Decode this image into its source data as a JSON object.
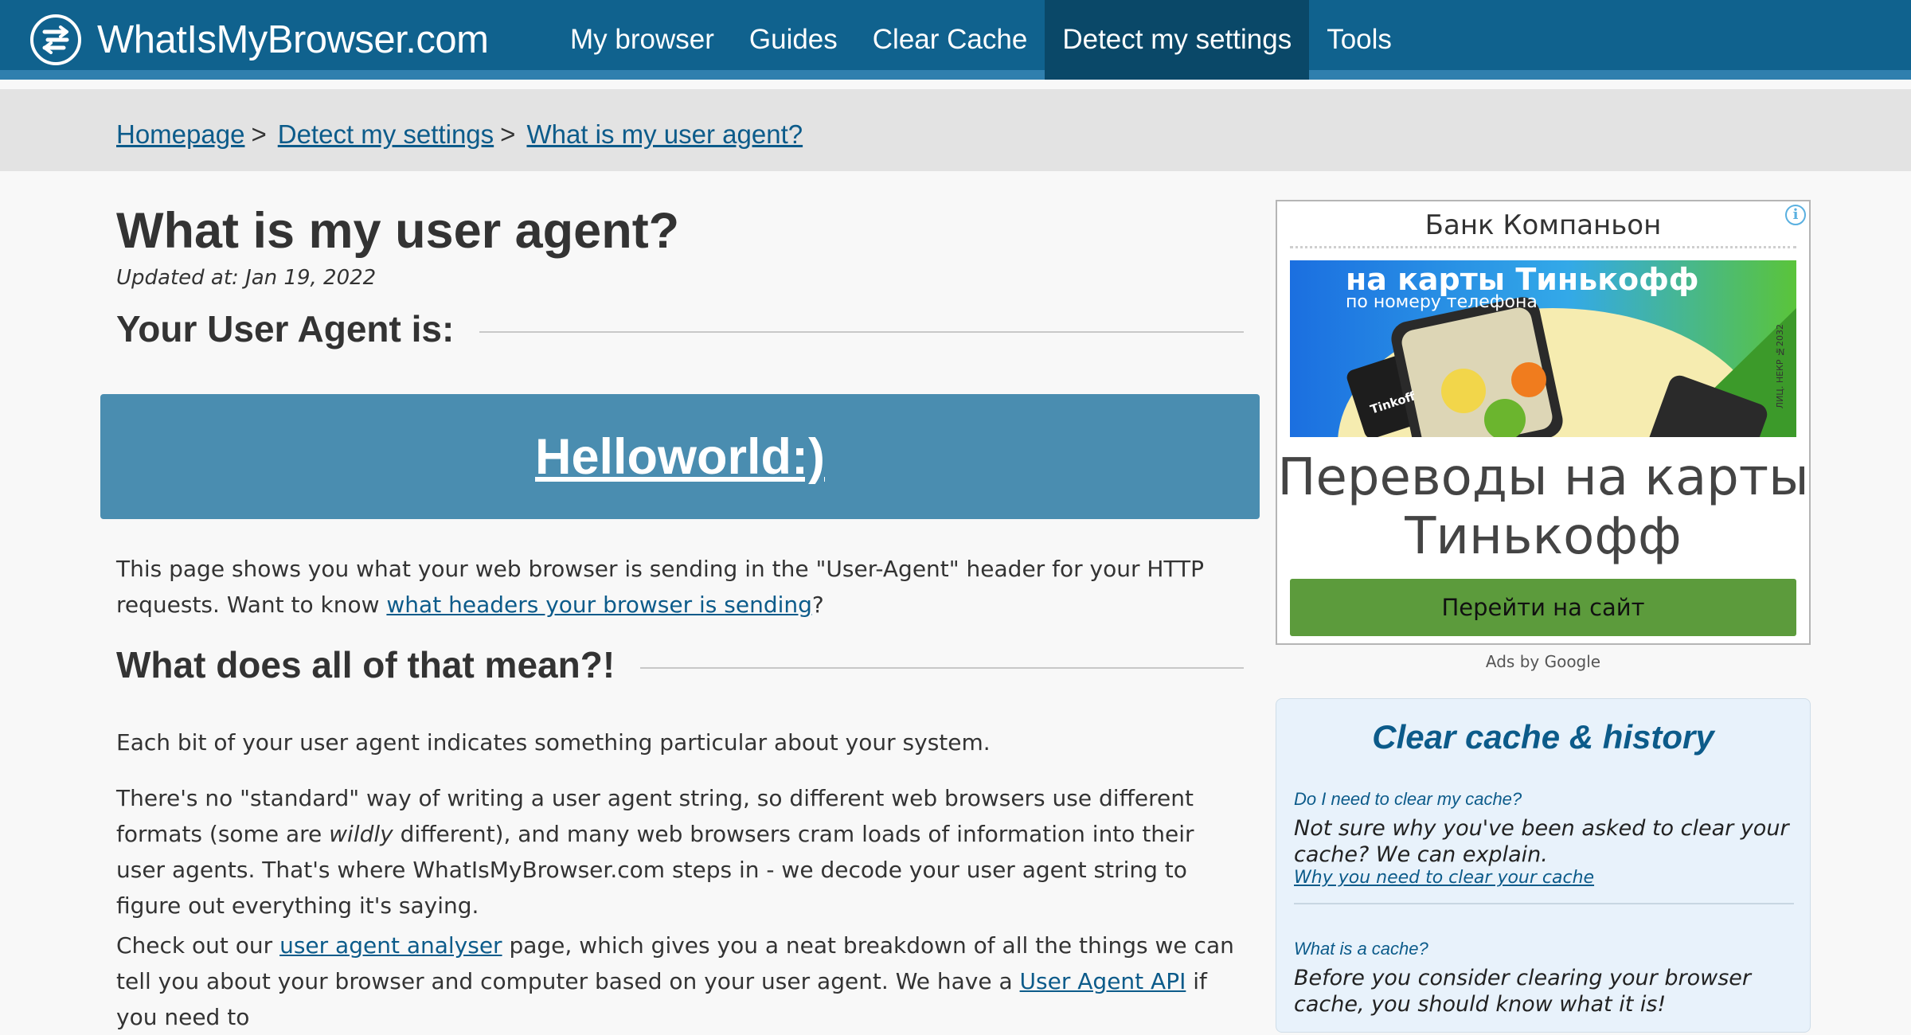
{
  "header": {
    "brand": "WhatIsMyBrowser.com",
    "nav": [
      {
        "label": "My browser",
        "active": false
      },
      {
        "label": "Guides",
        "active": false
      },
      {
        "label": "Clear Cache",
        "active": false
      },
      {
        "label": "Detect my settings",
        "active": true
      },
      {
        "label": "Tools",
        "active": false
      }
    ]
  },
  "breadcrumb": [
    {
      "label": "Homepage"
    },
    {
      "label": "Detect my settings"
    },
    {
      "label": "What is my user agent?"
    }
  ],
  "breadcrumb_separator": ">",
  "main": {
    "title": "What is my user agent?",
    "updated": "Updated at: Jan 19, 2022",
    "ua_heading": "Your User Agent is:",
    "user_agent": "Helloworld:)",
    "p1_text_a": "This page shows you what your web browser is sending in the \"User-Agent\" header for your HTTP requests. Want to know ",
    "p1_link": "what headers your browser is sending",
    "p1_text_b": "?",
    "meaning_heading": "What does all of that mean?!",
    "p2": "Each bit of your user agent indicates something particular about your system.",
    "p3_text_a": "There's no \"standard\" way of writing a user agent string, so different web browsers use different formats (some are ",
    "p3_em": "wildly",
    "p3_text_b": " different), and many web browsers cram loads of information into their user agents. That's where WhatIsMyBrowser.com steps in - we decode your user agent string to figure out everything it's saying.",
    "p4_text_a": "Check out our ",
    "p4_link1": "user agent analyser",
    "p4_text_b": " page, which gives you a neat breakdown of all the things we can tell you about your browser and computer based on your user agent. We have a ",
    "p4_link2": "User Agent API",
    "p4_text_c": " if you need to"
  },
  "ad": {
    "info_icon": "info-icon",
    "advertiser": "Банк Компаньон",
    "image_line1": "на карты Тинькофф",
    "image_line2": "по номеру телефона",
    "image_license": "ЛИЦ. НЕКР №2032",
    "image_card_label": "Tinkoff",
    "headline": "Переводы на карты Тинькофф",
    "button": "Перейти на сайт",
    "ads_by": "Ads by Google"
  },
  "sidebar_card": {
    "title": "Clear cache & history",
    "items": [
      {
        "heading": "Do I need to clear my cache?",
        "text": "Not sure why you've been asked to clear your cache? We can explain.",
        "link": "Why you need to clear your cache"
      },
      {
        "heading": "What is a cache?",
        "text": "Before you consider clearing your browser cache, you should know what it is!"
      }
    ]
  },
  "colors": {
    "header_bg": "#10628e",
    "nav_active_bg": "#0a4868",
    "ua_box_bg": "#4a8db0",
    "link": "#0c5b8a",
    "ad_button": "#5c9b3c",
    "card_bg": "#e8f2fb"
  }
}
